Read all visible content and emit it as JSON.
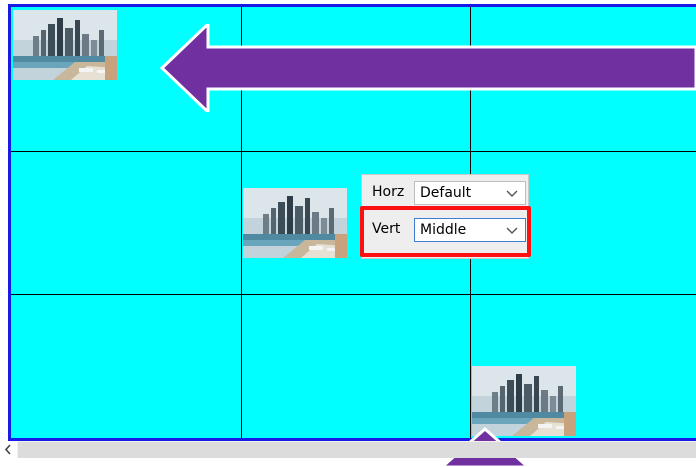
{
  "colors": {
    "canvas_bg": "#00ffff",
    "canvas_border": "#1a1ae6",
    "arrow": "#7030a0",
    "highlight": "#ff1010"
  },
  "images": [
    {
      "name": "city-skyline-image-top-left",
      "icon": "city-skyline-thumbnail"
    },
    {
      "name": "city-skyline-image-middle",
      "icon": "city-skyline-thumbnail"
    },
    {
      "name": "city-skyline-image-bottom",
      "icon": "city-skyline-thumbnail"
    }
  ],
  "alignment_panel": {
    "horz_label": "Horz",
    "horz_value": "Default",
    "vert_label": "Vert",
    "vert_value": "Middle"
  },
  "arrows": {
    "top": {
      "icon": "left-arrow-icon",
      "direction": "left"
    },
    "bottom": {
      "icon": "up-arrow-icon",
      "direction": "up"
    }
  },
  "scrollbar": {
    "left_icon": "chevron-left-icon"
  }
}
